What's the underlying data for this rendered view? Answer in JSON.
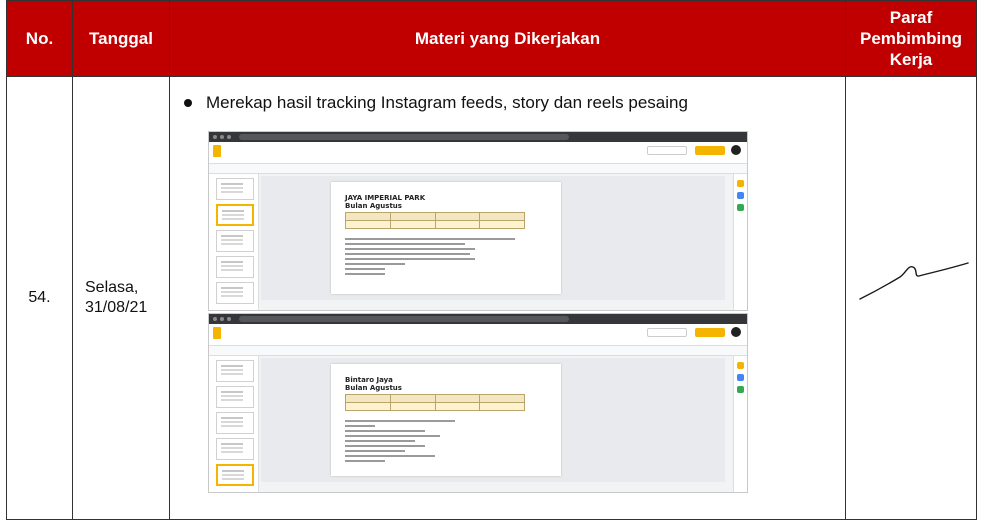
{
  "header": {
    "no": "No.",
    "tanggal": "Tanggal",
    "materi": "Materi yang Dikerjakan",
    "paraf_line1": "Paraf",
    "paraf_line2": "Pembimbing",
    "paraf_line3": "Kerja"
  },
  "entry": {
    "no": "54.",
    "day": "Selasa,",
    "date": "31/08/21",
    "task": "Merekap hasil tracking Instagram feeds, story dan reels pesaing"
  },
  "screenshot_1": {
    "slide_title_1": "JAYA IMPERIAL PARK",
    "slide_title_2": "Bulan Agustus"
  },
  "screenshot_2": {
    "slide_title_1": "Bintaro Jaya",
    "slide_title_2": "Bulan Agustus"
  },
  "colors": {
    "header_bg": "#c00000",
    "header_text": "#ffffff",
    "table_highlight": "#fff3cf"
  }
}
